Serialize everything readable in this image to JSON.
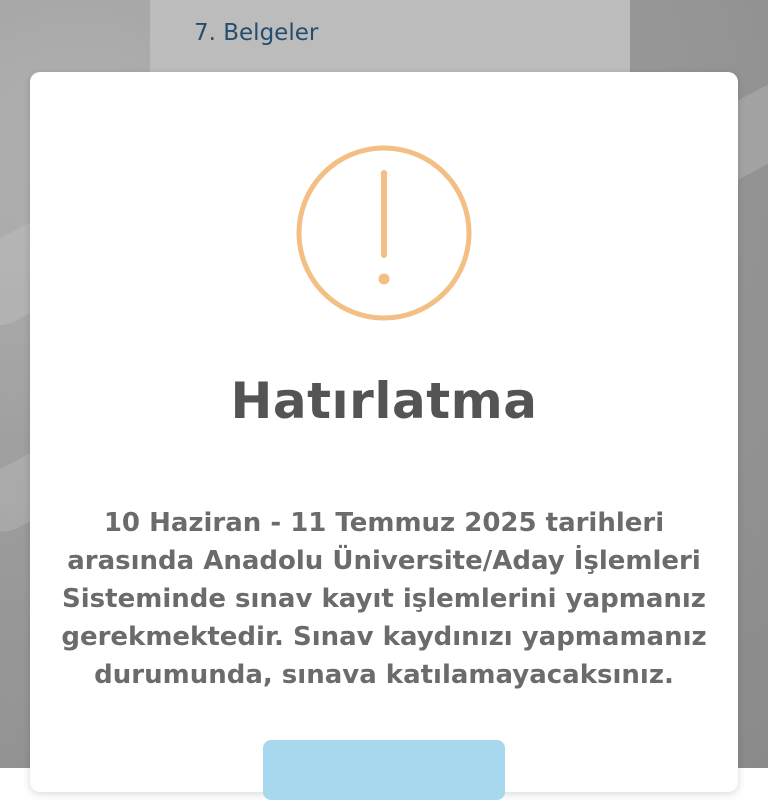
{
  "background": {
    "link_text": "7. Belgeler"
  },
  "dialog": {
    "icon": "exclamation-circle-icon",
    "icon_color": "#f4bf85",
    "title": "Hatırlatma",
    "message_lines": [
      "10 Haziran - 11 Temmuz 2025 tarihleri",
      "arasında Anadolu Üniversite/Aday İşlemleri",
      "Sisteminde sınav kayıt işlemlerini yapmanız",
      "gerekmektedir. Sınav kaydınızı yapmamanız",
      "durumunda, sınava katılamayacaksınız."
    ],
    "confirm_button_color": "#a8d8ee"
  }
}
